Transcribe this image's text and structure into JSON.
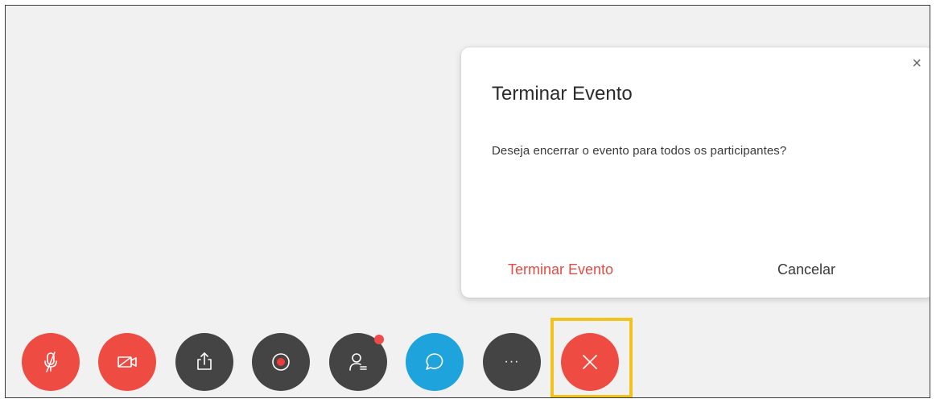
{
  "dialog": {
    "title": "Terminar Evento",
    "message": "Deseja encerrar o evento para todos os participantes?",
    "close_glyph": "×",
    "confirm_label": "Terminar Evento",
    "cancel_label": "Cancelar"
  },
  "toolbar": {
    "more_glyph": "···",
    "buttons": [
      {
        "id": "mute",
        "icon": "microphone-muted-icon",
        "color": "#ee4b43"
      },
      {
        "id": "video",
        "icon": "video-off-icon",
        "color": "#ee4b43"
      },
      {
        "id": "share",
        "icon": "share-icon",
        "color": "#444444"
      },
      {
        "id": "record",
        "icon": "record-icon",
        "color": "#444444"
      },
      {
        "id": "participants",
        "icon": "participants-icon",
        "color": "#444444"
      },
      {
        "id": "chat",
        "icon": "chat-icon",
        "color": "#1ea3dc"
      },
      {
        "id": "more",
        "icon": "more-options-icon",
        "color": "#444444"
      },
      {
        "id": "end",
        "icon": "close-icon",
        "color": "#ee4b43"
      }
    ]
  },
  "colors": {
    "danger": "#e24c45",
    "highlight": "#f2c21d",
    "badge": "#ef4b4b"
  }
}
